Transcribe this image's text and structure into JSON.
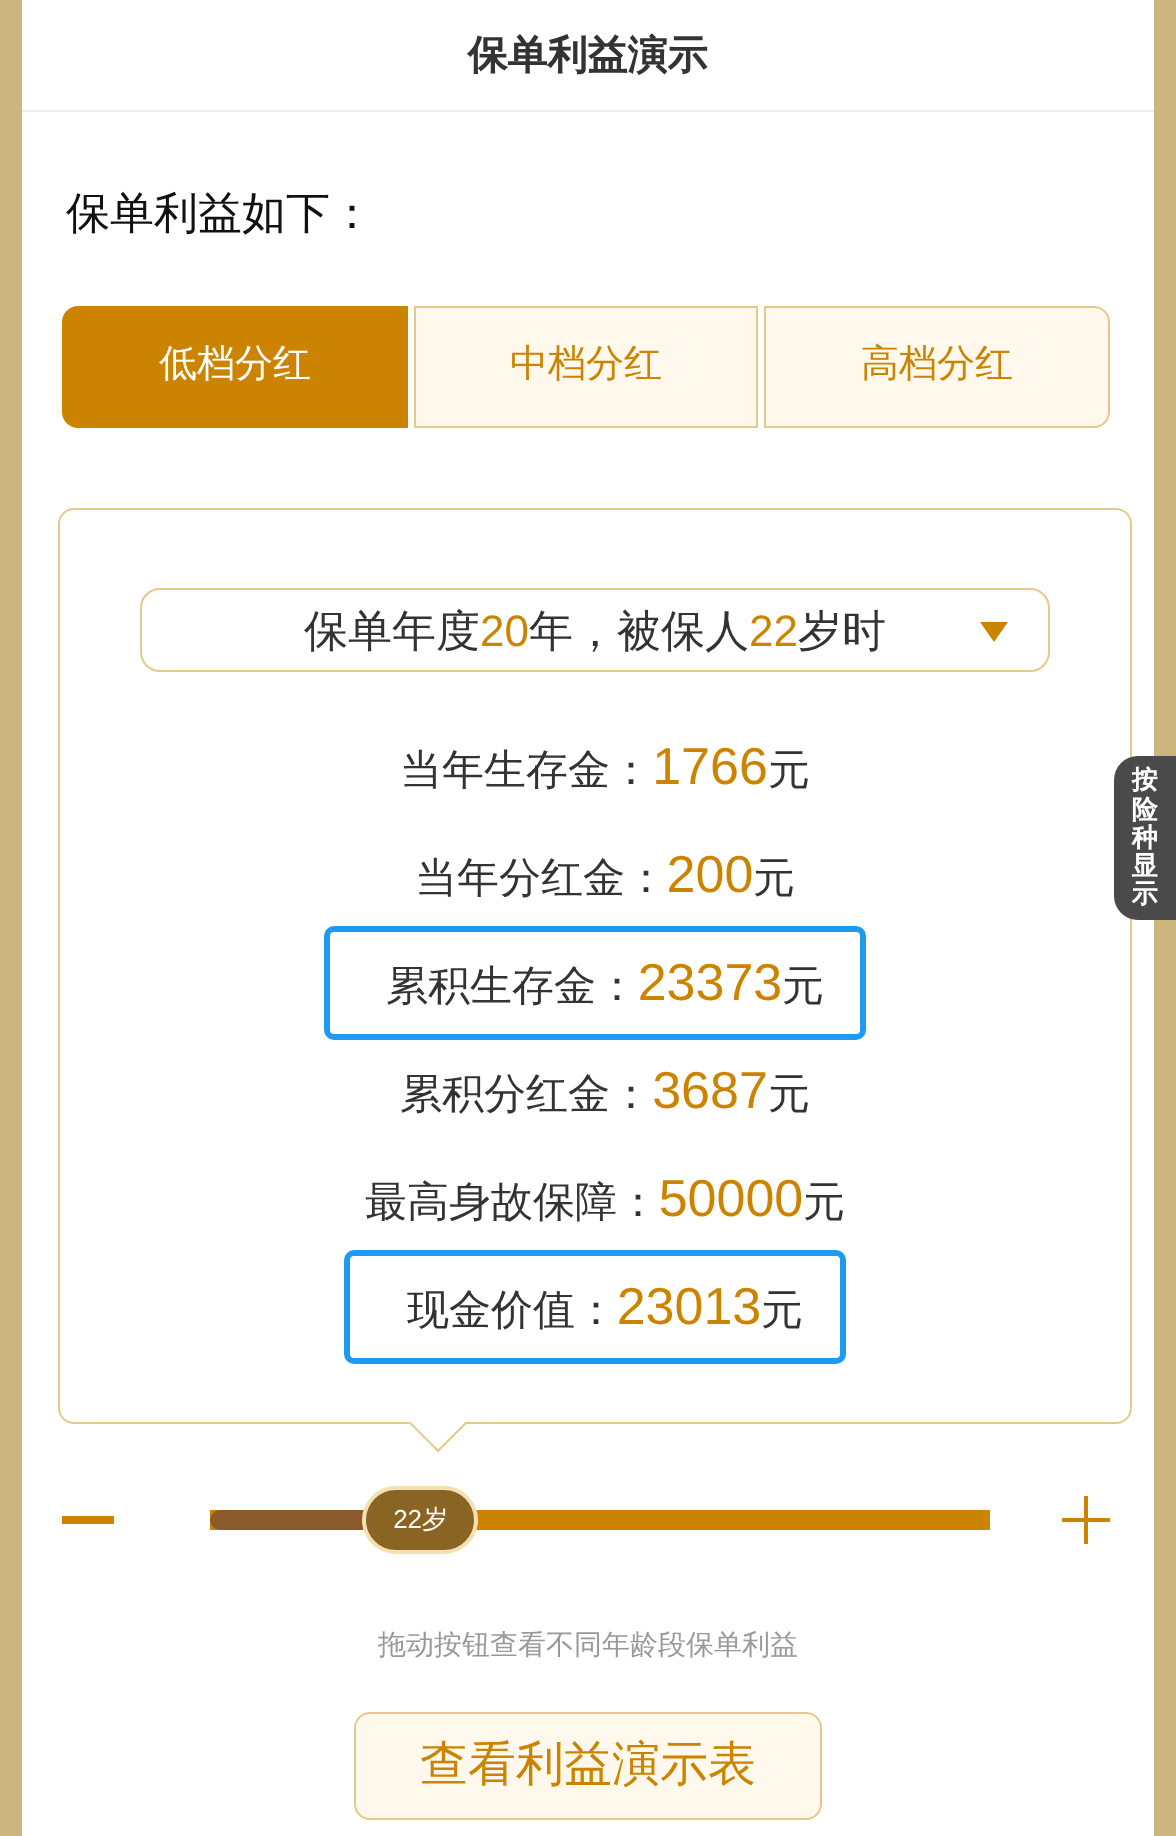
{
  "header": {
    "title": "保单利益演示"
  },
  "intro": "保单利益如下：",
  "tabs": [
    {
      "label": "低档分红",
      "selected": true
    },
    {
      "label": "中档分红",
      "selected": false
    },
    {
      "label": "高档分红",
      "selected": false
    }
  ],
  "selector": {
    "prefix": "保单年度",
    "year": "20",
    "middle": "年，被保人",
    "age": "22",
    "suffix": "岁时"
  },
  "stats": [
    {
      "label": "当年生存金：",
      "value": "1766",
      "unit": "元",
      "highlighted": false
    },
    {
      "label": "当年分红金：",
      "value": "200",
      "unit": "元",
      "highlighted": false
    },
    {
      "label": "累积生存金：",
      "value": "23373",
      "unit": "元",
      "highlighted": true
    },
    {
      "label": "累积分红金：",
      "value": "3687",
      "unit": "元",
      "highlighted": false
    },
    {
      "label": "最高身故保障：",
      "value": "50000",
      "unit": "元",
      "highlighted": false
    },
    {
      "label": "现金价值：",
      "value": "23013",
      "unit": "元",
      "highlighted": true
    }
  ],
  "side_tab": "按险种显示",
  "slider": {
    "level": 0.27,
    "thumb_label": "22岁"
  },
  "hint": "拖动按钮查看不同年龄段保单利益",
  "button": "查看利益演示表"
}
